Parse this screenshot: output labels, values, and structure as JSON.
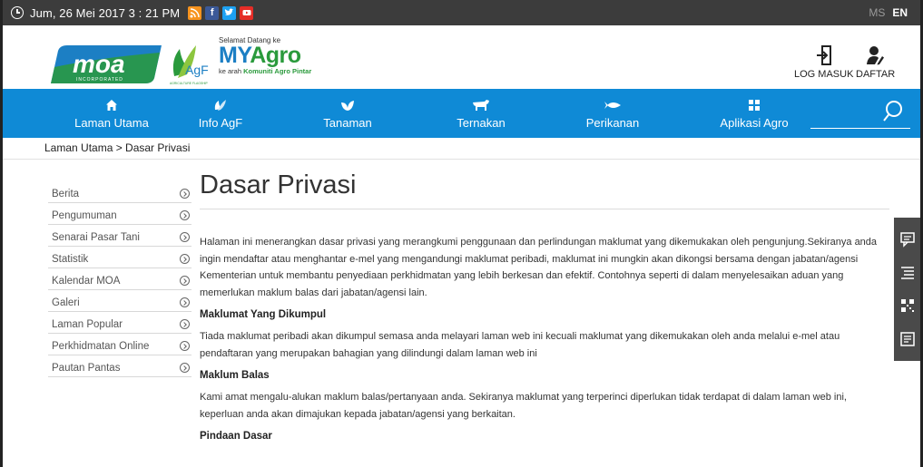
{
  "topbar": {
    "datetime": "Jum, 26 Mei 2017  3 : 21  PM",
    "social": [
      "rss-icon",
      "facebook-icon",
      "twitter-icon",
      "youtube-icon"
    ],
    "lang_ms": "MS",
    "lang_en": "EN"
  },
  "header": {
    "moa_text": "moa",
    "moa_sub": "INCORPORATED",
    "agf_text": "AgF",
    "agf_sub": "AGRICULTURE FLAGSHIP",
    "welcome": "Selamat Datang ke",
    "brand_my": "MY",
    "brand_agro": "Agro",
    "tag_prefix": "ke arah ",
    "tag_bold": "Komuniti Agro Pintar",
    "login_label": "LOG MASUK",
    "register_label": "DAFTAR"
  },
  "nav": {
    "items": [
      {
        "label": "Laman Utama",
        "icon": "home-icon"
      },
      {
        "label": "Info AgF",
        "icon": "leaf-tree-icon"
      },
      {
        "label": "Tanaman",
        "icon": "plant-icon"
      },
      {
        "label": "Ternakan",
        "icon": "cow-icon"
      },
      {
        "label": "Perikanan",
        "icon": "fish-icon"
      },
      {
        "label": "Aplikasi Agro",
        "icon": "apps-icon"
      }
    ]
  },
  "breadcrumb": "Laman Utama > Dasar Privasi",
  "sidebar": {
    "items": [
      "Berita",
      "Pengumuman",
      "Senarai Pasar Tani",
      "Statistik",
      "Kalendar MOA",
      "Galeri",
      "Laman Popular",
      "Perkhidmatan Online",
      "Pautan Pantas"
    ]
  },
  "main": {
    "title": "Dasar Privasi",
    "intro": "Halaman ini menerangkan dasar privasi yang merangkumi penggunaan dan perlindungan maklumat yang dikemukakan oleh pengunjung.Sekiranya anda ingin mendaftar atau menghantar e-mel yang mengandungi maklumat peribadi, maklumat ini mungkin akan dikongsi bersama dengan jabatan/agensi Kementerian untuk membantu penyediaan perkhidmatan yang lebih berkesan dan efektif.  Contohnya seperti di dalam menyelesaikan aduan yang memerlukan maklum balas dari jabatan/agensi lain.",
    "sections": [
      {
        "heading": "Maklumat Yang Dikumpul",
        "body": "Tiada maklumat peribadi akan dikumpul semasa anda melayari laman web ini kecuali maklumat yang dikemukakan oleh anda melalui e-mel atau pendaftaran yang merupakan bahagian yang dilindungi dalam laman web ini"
      },
      {
        "heading": "Maklum Balas",
        "body": "Kami amat mengalu-alukan maklum balas/pertanyaan anda. Sekiranya maklumat yang terperinci diperlukan tidak terdapat di dalam laman web ini, keperluan anda akan dimajukan kepada jabatan/agensi yang berkaitan."
      },
      {
        "heading": "Pindaan Dasar",
        "body": ""
      }
    ]
  },
  "colors": {
    "nav_bg": "#0f8ad6",
    "topbar_bg": "#3c3c3c",
    "brand_blue": "#1c7fc4",
    "brand_green": "#2a9a3c"
  }
}
